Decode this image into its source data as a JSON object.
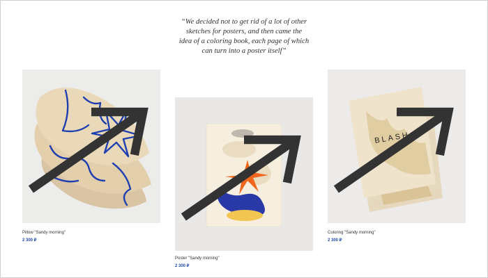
{
  "quote": {
    "lines": [
      "“We decided not to get rid of a lot of other",
      "sketches for posters, and then came the",
      "idea of a coloring book, each page of which",
      "can turn into a poster itself”"
    ]
  },
  "products": [
    {
      "name": "Pillow \"Sandy morning\"",
      "price": "2 300 ₽",
      "icon": "arrow-up-right-icon"
    },
    {
      "name": "Poster \"Sandy morning\"",
      "price": "2 300 ₽",
      "icon": "arrow-up-right-icon"
    },
    {
      "name": "Coloring \"Sandy morning\"",
      "price": "2 300 ₽",
      "icon": "arrow-up-right-icon",
      "book_title": "BLASH"
    }
  ],
  "colors": {
    "price": "#1f4ca6",
    "accent_blue": "#1f3fb0",
    "accent_orange": "#f0661c",
    "sand": "#e8d6b4",
    "yellow": "#f3c552"
  }
}
